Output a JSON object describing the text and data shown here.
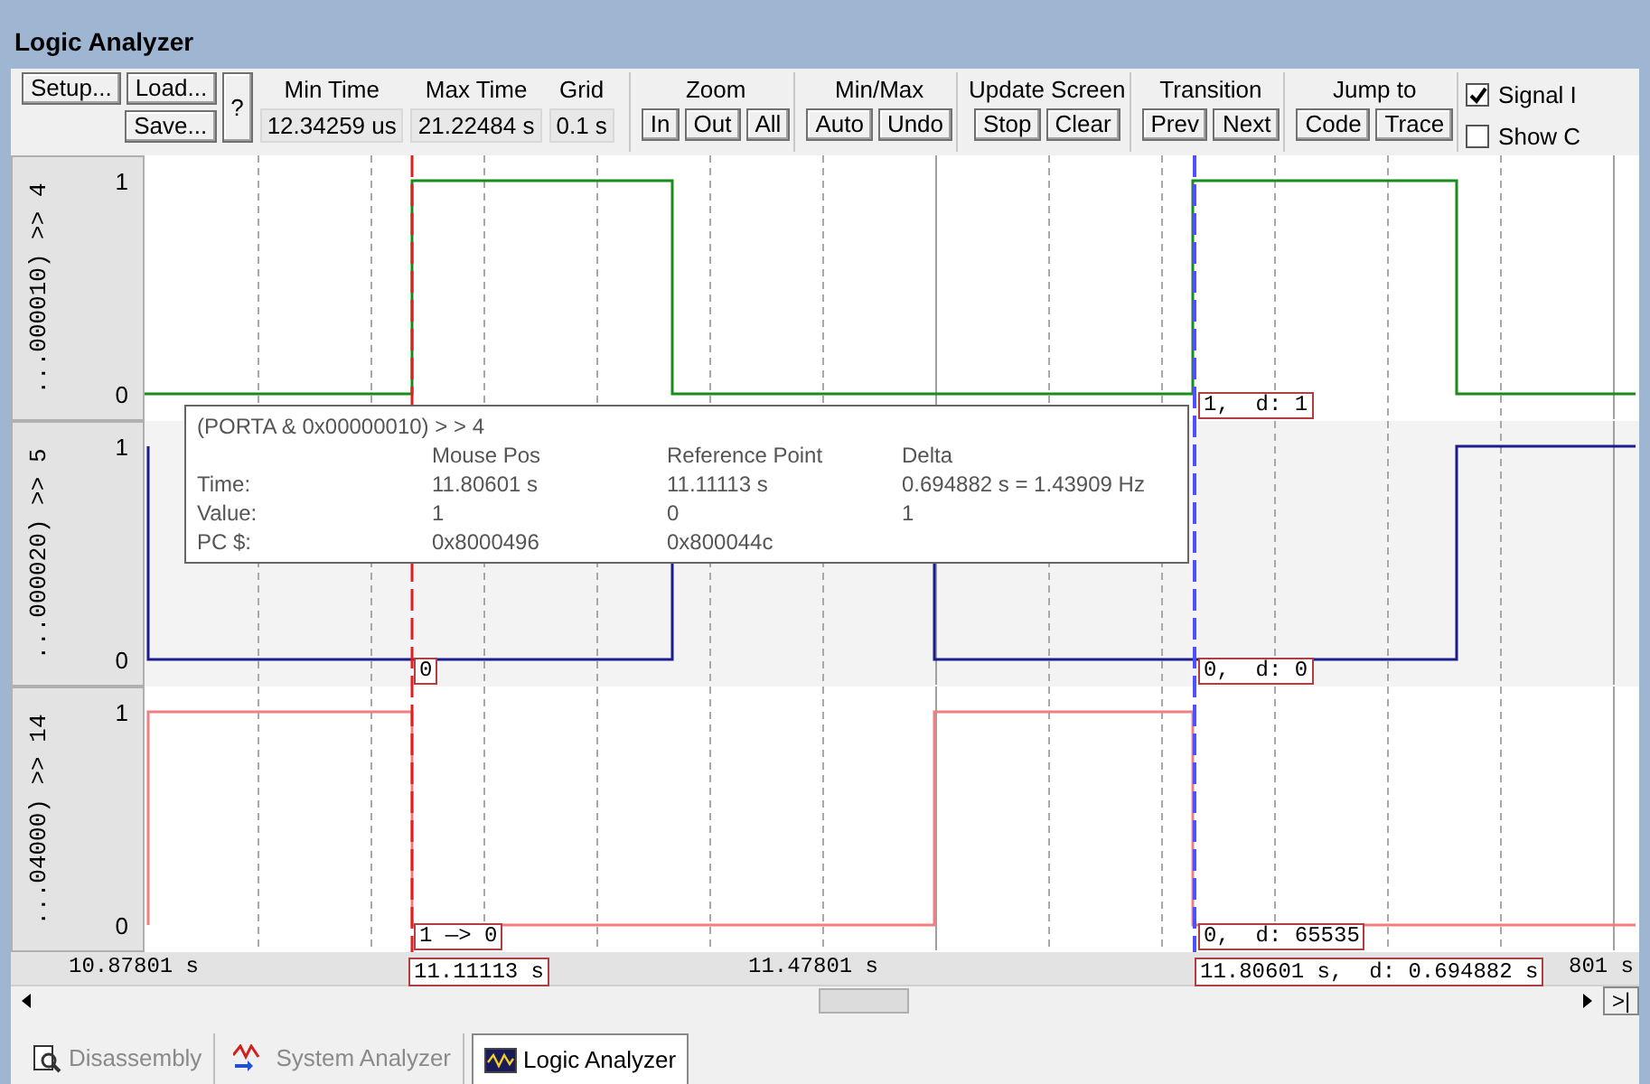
{
  "window": {
    "title": "Logic Analyzer"
  },
  "toolbar": {
    "file_buttons": [
      "Setup...",
      "Load...",
      "Save..."
    ],
    "help_button": "?",
    "readouts": [
      {
        "label": "Min Time",
        "value": "12.34259 us"
      },
      {
        "label": "Max Time",
        "value": "21.22484 s"
      },
      {
        "label": "Grid",
        "value": "0.1 s"
      }
    ],
    "groups": [
      {
        "label": "Zoom",
        "buttons": [
          "In",
          "Out",
          "All"
        ]
      },
      {
        "label": "Min/Max",
        "buttons": [
          "Auto",
          "Undo"
        ]
      },
      {
        "label": "Update Screen",
        "buttons": [
          "Stop",
          "Clear"
        ]
      },
      {
        "label": "Transition",
        "buttons": [
          "Prev",
          "Next"
        ]
      },
      {
        "label": "Jump to",
        "buttons": [
          "Code",
          "Trace"
        ]
      }
    ],
    "options": [
      {
        "label": "Signal I",
        "checked": true
      },
      {
        "label": "Show C",
        "checked": false
      }
    ]
  },
  "channels": [
    {
      "name": "...000010) >> 4",
      "high_label": "1",
      "low_label": "0",
      "color": "#1a8c1a",
      "cursor_value": "1,  d: 1"
    },
    {
      "name": "...000020) >> 5",
      "high_label": "1",
      "low_label": "0",
      "color": "#1c1c8c",
      "reference_value": "0",
      "cursor_value": "0,  d: 0"
    },
    {
      "name": "...04000) >> 14",
      "high_label": "1",
      "low_label": "0",
      "color": "#f08080",
      "reference_value": "1 —> 0",
      "cursor_value": "0,  d: 65535"
    }
  ],
  "tooltip": {
    "title": "(PORTA & 0x00000010) > > 4",
    "columns": [
      "Mouse Pos",
      "Reference Point",
      "Delta"
    ],
    "rows": [
      {
        "label": "Time:",
        "cells": [
          "11.80601 s",
          "11.11113 s",
          "0.694882 s = 1.43909 Hz"
        ]
      },
      {
        "label": "Value:",
        "cells": [
          "1",
          "0",
          "1"
        ]
      },
      {
        "label": "PC $:",
        "cells": [
          "0x8000496",
          "0x800044c"
        ]
      }
    ]
  },
  "time_axis": [
    {
      "kind": "tick",
      "text": "10.87801 s"
    },
    {
      "kind": "reference",
      "text": "11.11113 s"
    },
    {
      "kind": "tick",
      "text": "11.47801 s"
    },
    {
      "kind": "cursor",
      "text": "11.80601 s,  d: 0.694882 s"
    },
    {
      "kind": "tick",
      "text": "801 s"
    }
  ],
  "scrollbar": {
    "end_button": ">|"
  },
  "tabs": [
    {
      "label": "Disassembly",
      "selected": false
    },
    {
      "label": "System Analyzer",
      "selected": false
    },
    {
      "label": "Logic Analyzer",
      "selected": true
    }
  ]
}
